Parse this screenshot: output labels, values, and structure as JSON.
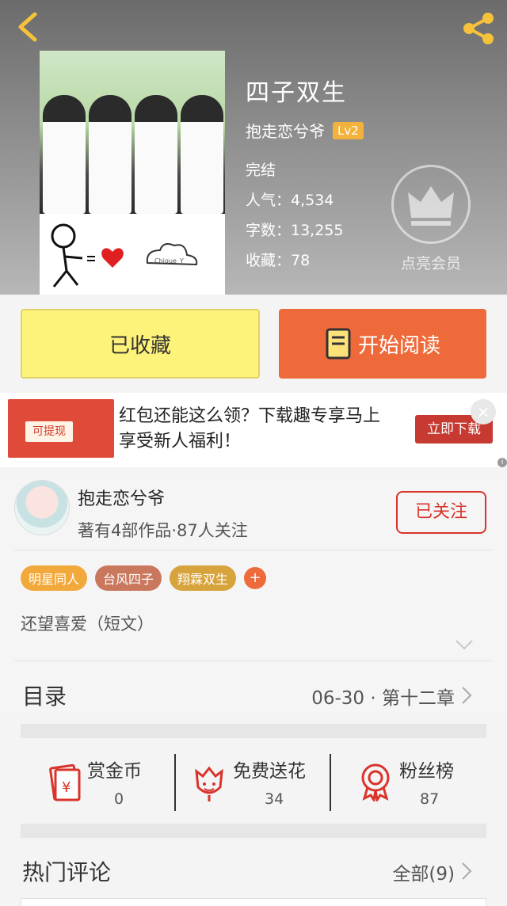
{
  "header": {
    "title": "四子双生",
    "author": "抱走恋兮爷",
    "level": "Lv2",
    "status": "完结",
    "popularity": "人气：4,534",
    "word_count": "字数：13,255",
    "favorites": "收藏：78",
    "vip_label": "点亮会员"
  },
  "actions": {
    "collected_label": "已收藏",
    "read_label": "开始阅读"
  },
  "ad": {
    "image_text": "可提现",
    "text": "红包还能这么领？下载趣专享马上享受新人福利！",
    "download_label": "立即下载",
    "close_icon": "×"
  },
  "author_card": {
    "name": "抱走恋兮爷",
    "meta": "著有4部作品·87人关注",
    "follow_label": "已关注",
    "tags": [
      "明星同人",
      "台风四子",
      "翔霖双生"
    ],
    "tag_colors": [
      "#f2a93b",
      "#c9785d",
      "#d7a33c"
    ],
    "tag_add": "+",
    "summary": "还望喜爱（短文）"
  },
  "catalog": {
    "title": "目录",
    "latest": "06-30 · 第十二章"
  },
  "stats": {
    "reward_label": "赏金币",
    "reward_value": "0",
    "flower_label": "免费送花",
    "flower_value": "34",
    "fans_label": "粉丝榜",
    "fans_value": "87"
  },
  "comments": {
    "title": "热门评论",
    "all_label": "全部(9)"
  },
  "colors": {
    "accent_orange": "#ef6a3a",
    "collected_yellow": "#fdf27a",
    "follow_red": "#d9342b",
    "icon_red": "#d9342b",
    "level_badge": "#f3b23b"
  }
}
